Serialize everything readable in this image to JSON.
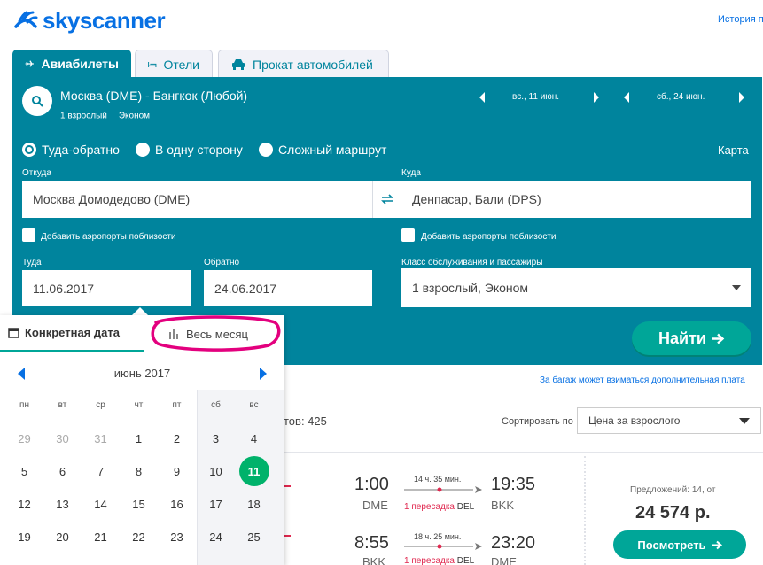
{
  "header": {
    "logo_text": "skyscanner",
    "history_link": "История п"
  },
  "tabs": [
    {
      "label": "Авиабилеты",
      "icon": "plane-icon",
      "active": true
    },
    {
      "label": "Отели",
      "icon": "bed-icon",
      "active": false
    },
    {
      "label": "Прокат автомобилей",
      "icon": "car-icon",
      "active": false
    }
  ],
  "summary": {
    "route": "Москва (DME) - Бангкок (Любой)",
    "passengers": "1 взрослый",
    "cabin": "Эконом",
    "depart_nav": "вс., 11 июн.",
    "return_nav": "сб., 24 июн."
  },
  "trip_types": [
    {
      "label": "Туда-обратно",
      "selected": true
    },
    {
      "label": "В одну сторону",
      "selected": false
    },
    {
      "label": "Сложный маршрут",
      "selected": false
    }
  ],
  "map_link": "Карта",
  "from": {
    "label": "Откуда",
    "value": "Москва Домодедово (DME)",
    "nearby": "Добавить аэропорты поблизости"
  },
  "to": {
    "label": "Куда",
    "value": "Денпасар, Бали (DPS)",
    "nearby": "Добавить аэропорты поблизости"
  },
  "depart": {
    "label": "Туда",
    "value": "11.06.2017"
  },
  "return": {
    "label": "Обратно",
    "value": "24.06.2017"
  },
  "cabin_class": {
    "label": "Класс обслуживания и пассажиры",
    "value": "1 взрослый, Эконом"
  },
  "find_button": "Найти",
  "calendar": {
    "tab_specific": "Конкретная дата",
    "tab_month": "Весь месяц",
    "month": "июнь 2017",
    "weekdays": [
      "пн",
      "вт",
      "ср",
      "чт",
      "пт",
      "сб",
      "вс"
    ],
    "weeks": [
      [
        "29",
        "30",
        "31",
        "1",
        "2",
        "3",
        "4"
      ],
      [
        "5",
        "6",
        "7",
        "8",
        "9",
        "10",
        "11"
      ],
      [
        "12",
        "13",
        "14",
        "15",
        "16",
        "17",
        "18"
      ],
      [
        "19",
        "20",
        "21",
        "22",
        "23",
        "24",
        "25"
      ]
    ],
    "selected_day": "11"
  },
  "results": {
    "baggage_note": "За багаж может взиматься дополнительная плата",
    "count_text": "тов: 425",
    "sort_label": "Сортировать по",
    "sort_value": "Цена за взрослого",
    "card": {
      "outbound": {
        "dep_time": "1:00",
        "dep_code": "DME",
        "duration": "14 ч. 35 мин.",
        "stops": "1 пересадка",
        "via": "DEL",
        "arr_time": "19:35",
        "arr_code": "BKK"
      },
      "inbound": {
        "dep_time": "8:55",
        "dep_code": "BKK",
        "duration": "18 ч. 25 мин.",
        "stops": "1 пересадка",
        "via": "DEL",
        "arr_time": "23:20",
        "arr_code": "DME"
      },
      "offers": "Предложений: 14, от",
      "price": "24 574 р.",
      "view_button": "Посмотреть"
    }
  },
  "colors": {
    "brand": "#0770e3",
    "panel": "#00849d",
    "cta": "#00a698",
    "selected_day": "#00b26b",
    "annotation": "#e3007e",
    "stops_red": "#e0284f"
  }
}
